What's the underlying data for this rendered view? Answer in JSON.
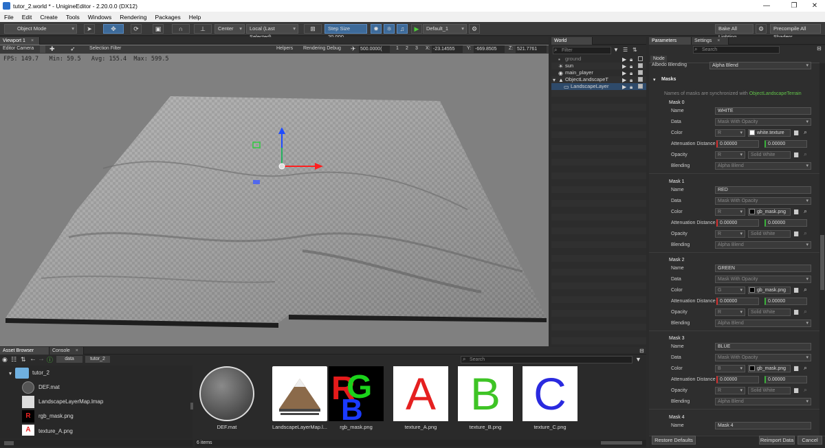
{
  "window": {
    "title": "tutor_2.world * - UnigineEditor - 2.20.0.0 (DX12)",
    "min": "—",
    "max": "❐",
    "close": "✕"
  },
  "menu": [
    "File",
    "Edit",
    "Create",
    "Tools",
    "Windows",
    "Rendering",
    "Packages",
    "Help"
  ],
  "toolbar": {
    "mode": "Object Mode",
    "pivot": "Center",
    "space": "Local (Last Selected)",
    "step_label": "Step Size",
    "step_value": "20.000",
    "preset": "Default_1",
    "bake": "Bake All Lighting",
    "precompile": "Precompile All Shaders"
  },
  "viewport": {
    "tab": "Viewport 1",
    "camera": "Editor Camera",
    "selection": "Selection Filter",
    "helpers": "Helpers",
    "rendering_debug": "Rendering Debug",
    "speed": "500.0000(",
    "nums": [
      "1",
      "2",
      "3"
    ],
    "x_label": "X:",
    "x": "-23.14555",
    "y_label": "Y:",
    "y": "-669.8505",
    "z_label": "Z:",
    "z": "521.7761",
    "fps": "FPS: 149.7   Min: 59.5   Avg: 155.4  Max: 599.5"
  },
  "world_nodes": {
    "tab": "World Nodes",
    "filter_placeholder": "Filter",
    "items": [
      {
        "label": "ground",
        "dim": true
      },
      {
        "label": "sun",
        "dim": false
      },
      {
        "label": "main_player",
        "dim": false
      },
      {
        "label": "ObjectLandscapeT",
        "dim": false
      },
      {
        "label": "LandscapeLayer",
        "dim": false
      }
    ]
  },
  "params": {
    "tab": "Parameters 1",
    "tab2": "Settings",
    "search_placeholder": "Search",
    "node_tab": "Node",
    "albedo_label": "Albedo Blending",
    "albedo_value": "Alpha Blend",
    "section": "Masks",
    "note_prefix": "Names of masks are synchronized with",
    "note_link": "ObjectLandscapeTerrain",
    "labels": {
      "name": "Name",
      "data": "Data",
      "color": "Color",
      "atten": "Attenuation Distance",
      "opacity": "Opacity",
      "blending": "Blending"
    },
    "masks": [
      {
        "title": "Mask 0",
        "name": "WHITE",
        "data": "Mask With Opacity",
        "channel": "R",
        "texture": "white.texture",
        "a1": "0.00000",
        "a2": "0.00000",
        "op": "R",
        "solid": "Solid White",
        "blend": "Alpha Blend"
      },
      {
        "title": "Mask 1",
        "name": "RED",
        "data": "Mask With Opacity",
        "channel": "R",
        "texture": "gb_mask.png",
        "a1": "0.00000",
        "a2": "0.00000",
        "op": "R",
        "solid": "Solid White",
        "blend": "Alpha Blend"
      },
      {
        "title": "Mask 2",
        "name": "GREEN",
        "data": "Mask With Opacity",
        "channel": "G",
        "texture": "gb_mask.png",
        "a1": "0.00000",
        "a2": "0.00000",
        "op": "R",
        "solid": "Solid White",
        "blend": "Alpha Blend"
      },
      {
        "title": "Mask 3",
        "name": "BLUE",
        "data": "Mask With Opacity",
        "channel": "B",
        "texture": "gb_mask.png",
        "a1": "0.00000",
        "a2": "0.00000",
        "op": "R",
        "solid": "Solid White",
        "blend": "Alpha Blend"
      }
    ],
    "mask4_title": "Mask 4",
    "mask4_name": "Mask 4",
    "restore": "Restore Defaults",
    "reimport": "Reimport Data",
    "cancel": "Cancel"
  },
  "asset_browser": {
    "tab": "Asset Browser 1",
    "tab2": "Console",
    "crumbs": [
      "data",
      "tutor_2"
    ],
    "search_placeholder": "Search",
    "tree": [
      "tutor_2",
      "DEF.mat",
      "LandscapeLayerMap.lmap",
      "rgb_mask.png",
      "texture_A.png"
    ],
    "thumbs": [
      "DEF.mat",
      "LandscapeLayerMap.l...",
      "rgb_mask.png",
      "texture_A.png",
      "texture_B.png",
      "texture_C.png"
    ],
    "count": "6 items"
  }
}
